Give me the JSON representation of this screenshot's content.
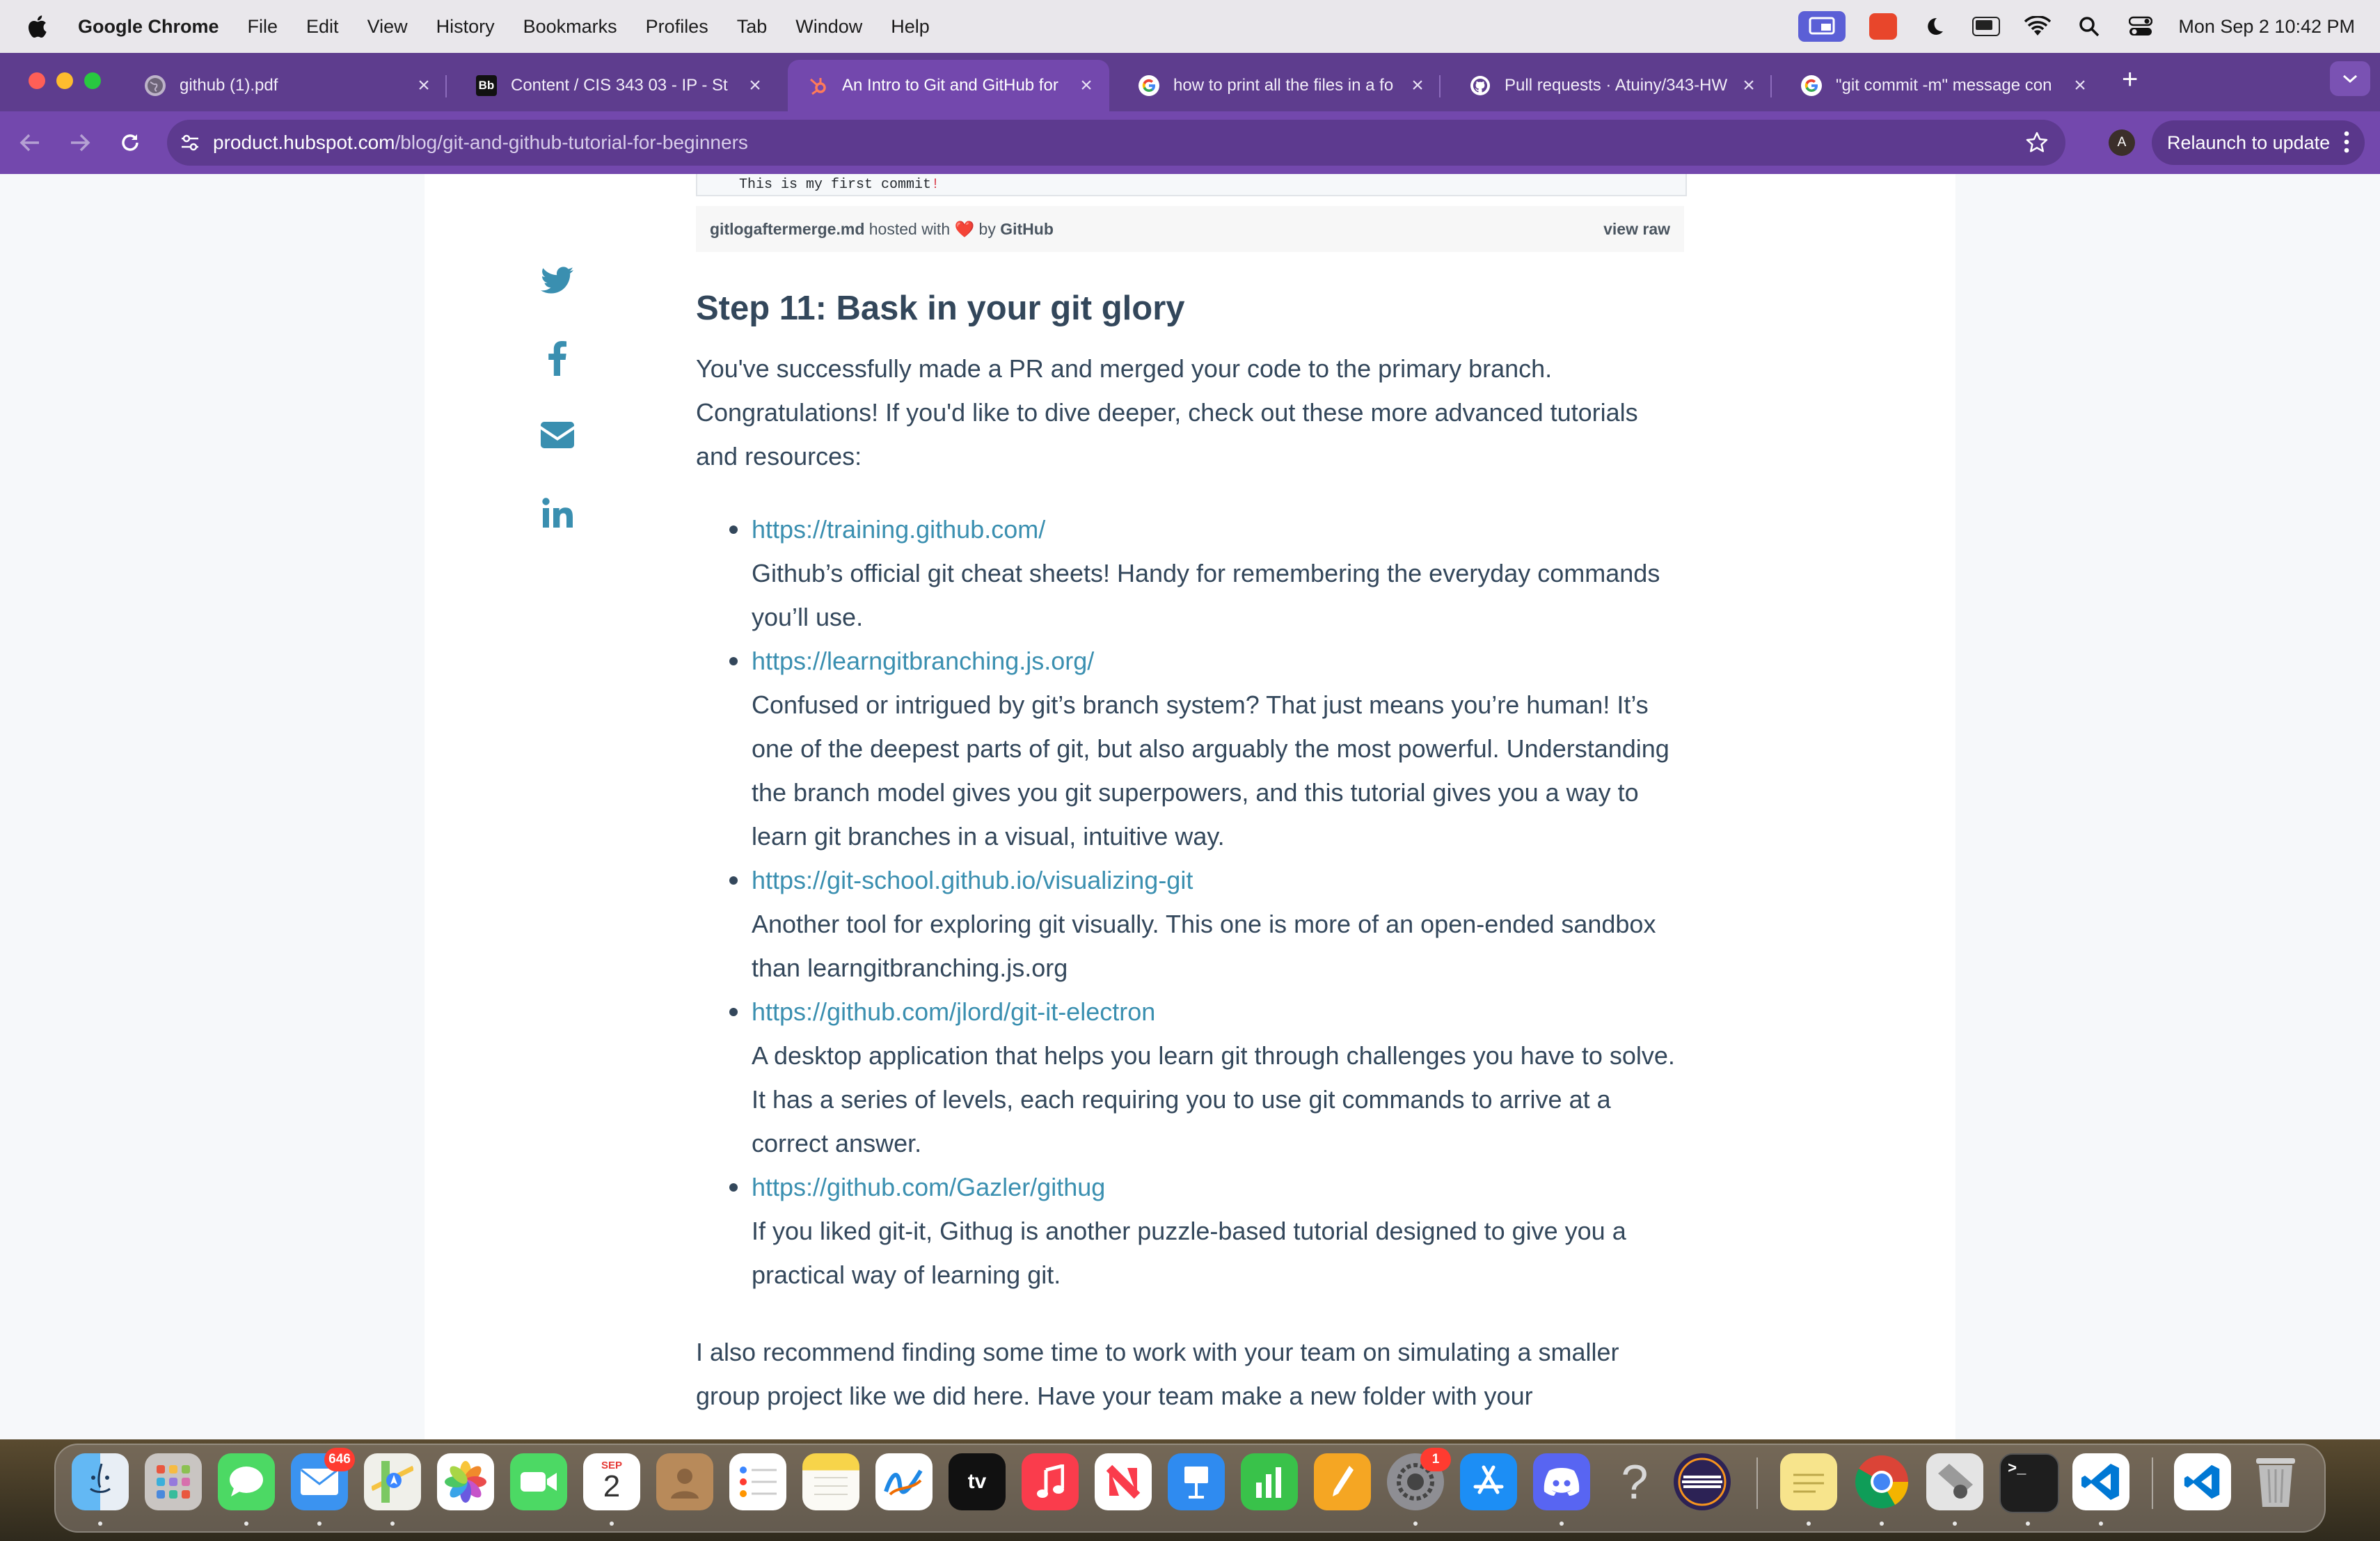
{
  "menubar": {
    "app_name": "Google Chrome",
    "items": [
      "File",
      "Edit",
      "View",
      "History",
      "Bookmarks",
      "Profiles",
      "Tab",
      "Window",
      "Help"
    ],
    "clock": "Mon Sep 2  10:42 PM"
  },
  "tabs": [
    {
      "title": "github (1).pdf",
      "favicon": "globe-icon",
      "active": false
    },
    {
      "title": "Content / CIS 343 03 - IP - St",
      "favicon": "Bb",
      "active": false
    },
    {
      "title": "An Intro to Git and GitHub for",
      "favicon": "hubspot-icon",
      "active": true
    },
    {
      "title": "how to print all the files in a fo",
      "favicon": "google-icon",
      "active": false
    },
    {
      "title": "Pull requests · Atuiny/343-HW",
      "favicon": "github-icon",
      "active": false
    },
    {
      "title": "\"git commit -m\" message con",
      "favicon": "google-icon",
      "active": false
    }
  ],
  "toolbar": {
    "url_domain": "product.hubspot.com",
    "url_path": "/blog/git-and-github-tutorial-for-beginners",
    "profile_initial": "A",
    "relaunch_label": "Relaunch to update"
  },
  "gist": {
    "code_line_before": "This is my first commit",
    "code_line_bang": "!",
    "filename": "gitlogaftermerge.md",
    "hosted_with": "hosted with",
    "by": "by",
    "host": "GitHub",
    "view_raw": "view raw"
  },
  "share": [
    "twitter-icon",
    "facebook-icon",
    "email-icon",
    "linkedin-icon"
  ],
  "article": {
    "heading": "Step 11: Bask in your git glory",
    "intro": "You've successfully made a PR and merged your code to the primary branch. Congratulations! If you'd like to dive deeper, check out these more advanced tutorials and resources:",
    "resources": [
      {
        "url": "https://training.github.com/",
        "desc": "Github’s official git cheat sheets! Handy for remembering the everyday commands you’ll use."
      },
      {
        "url": "https://learngitbranching.js.org/",
        "desc": "Confused or intrigued by git’s branch system? That just means you’re human! It’s one of the deepest parts of git, but also arguably the most powerful. Understanding the branch model gives you git superpowers, and this tutorial gives you a way to learn git branches in a visual, intuitive way."
      },
      {
        "url": "https://git-school.github.io/visualizing-git",
        "desc": "Another tool for exploring git visually. This one is more of an open-ended sandbox than learngitbranching.js.org"
      },
      {
        "url": "https://github.com/jlord/git-it-electron",
        "desc": "A desktop application that helps you learn git through challenges you have to solve. It has a series of levels, each requiring you to use git commands to arrive at a correct answer."
      },
      {
        "url": "https://github.com/Gazler/githug",
        "desc": "If you liked git-it, Githug is another puzzle-based tutorial designed to give you a practical way of learning git."
      }
    ],
    "outro": "I also recommend finding some time to work with your team on simulating a smaller group project like we did here. Have your team make a new folder with your"
  },
  "dock": {
    "mail_badge": "646",
    "calendar_month": "SEP",
    "calendar_day": "2",
    "settings_badge": "1",
    "apps": [
      "finder-icon",
      "launchpad-icon",
      "messages-icon",
      "mail-icon",
      "maps-icon",
      "photos-icon",
      "facetime-icon",
      "calendar-icon",
      "contacts-icon",
      "reminders-icon",
      "notes-icon",
      "freeform-icon",
      "tv-icon",
      "music-icon",
      "news-icon",
      "keynote-icon",
      "numbers-icon",
      "pages-icon",
      "system-settings-icon",
      "app-store-icon",
      "discord-icon",
      "help-icon",
      "eclipse-icon",
      "stickies-icon",
      "chrome-icon",
      "unknown-app-icon",
      "terminal-icon",
      "vscode-icon",
      "vscode-doc-icon",
      "trash-icon"
    ]
  }
}
